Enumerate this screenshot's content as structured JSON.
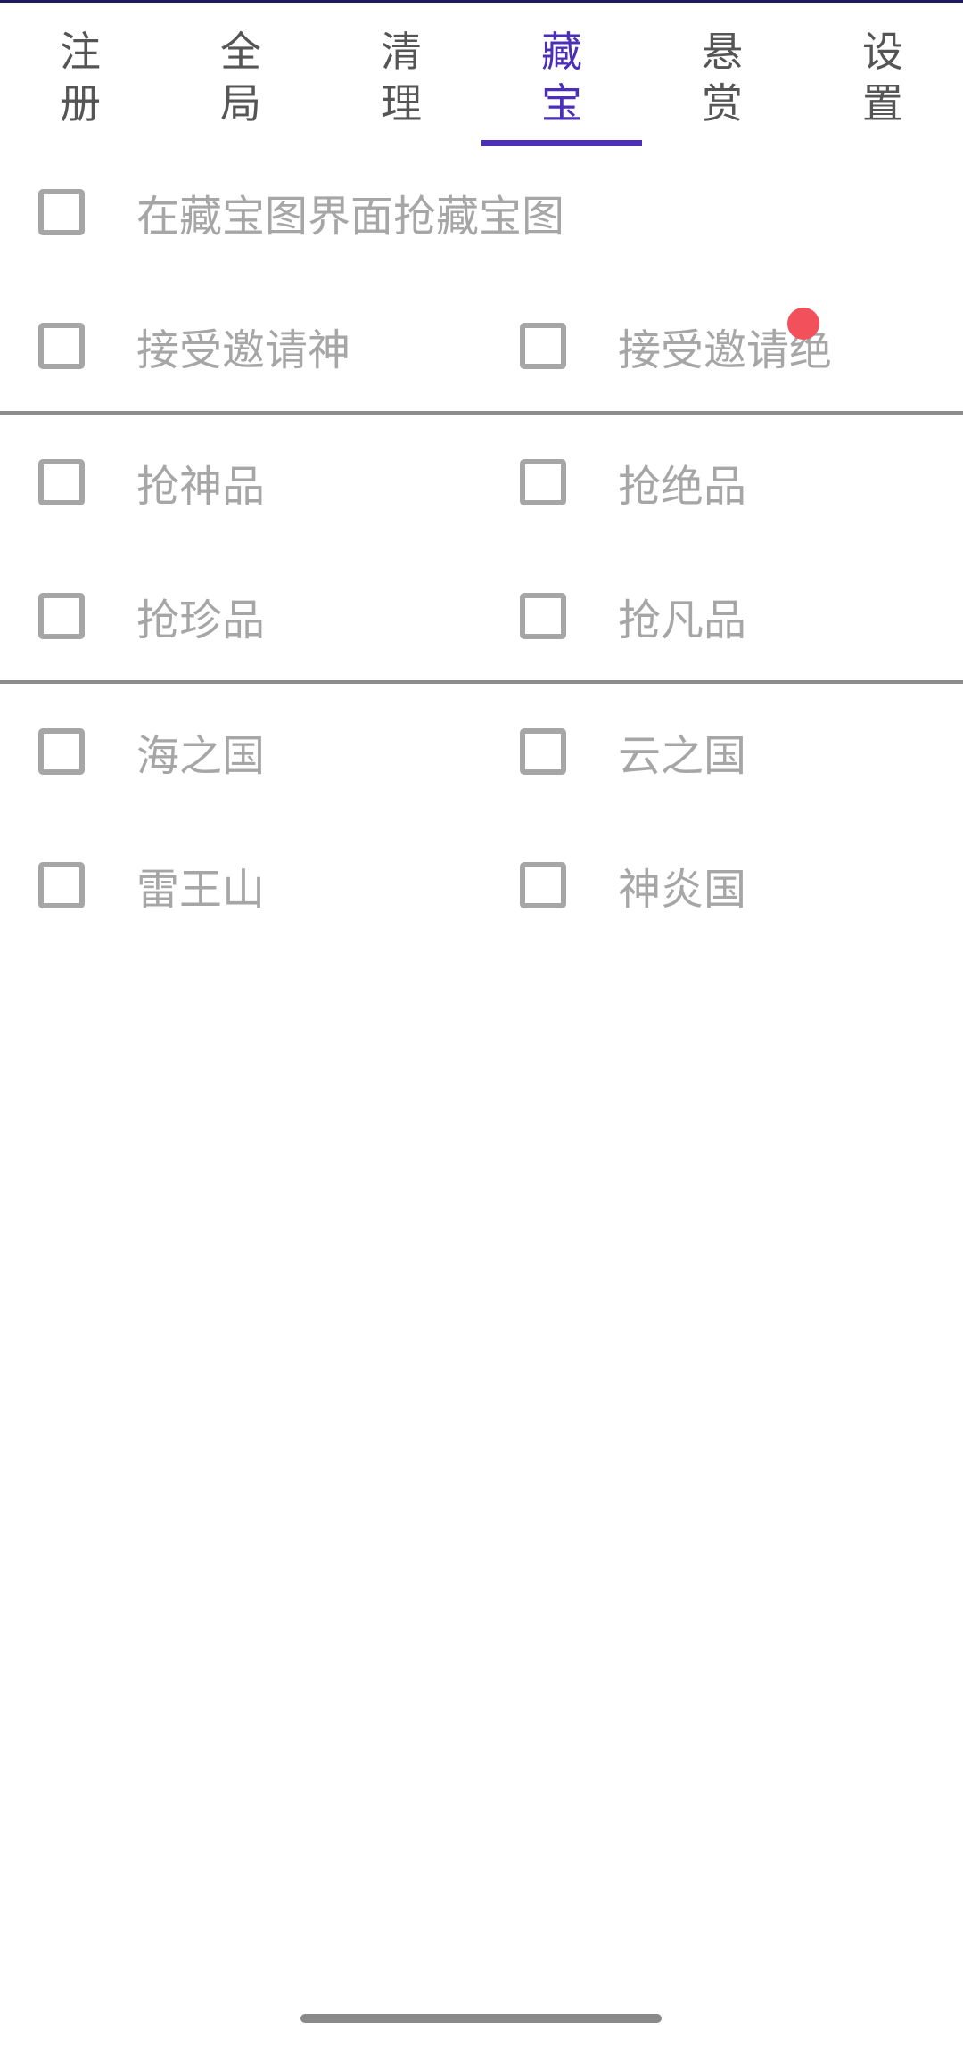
{
  "tabs": [
    {
      "line1": "注",
      "line2": "册"
    },
    {
      "line1": "全",
      "line2": "局"
    },
    {
      "line1": "清",
      "line2": "理"
    },
    {
      "line1": "藏",
      "line2": "宝"
    },
    {
      "line1": "悬",
      "line2": "赏"
    },
    {
      "line1": "设",
      "line2": "置"
    }
  ],
  "active_tab_index": 3,
  "colors": {
    "accent": "#4b2fb8",
    "checkbox_border": "#a6a6a6",
    "label_text": "#a6a6a6",
    "divider": "#8c8c8c",
    "notification_dot": "#f2505a"
  },
  "options": {
    "grab_map_in_map_screen": {
      "label": "在藏宝图界面抢藏宝图",
      "checked": false
    },
    "accept_invite_shen": {
      "label": "接受邀请神",
      "checked": false
    },
    "accept_invite_jue": {
      "label": "接受邀请绝",
      "checked": false
    },
    "grab_shen": {
      "label": "抢神品",
      "checked": false
    },
    "grab_jue": {
      "label": "抢绝品",
      "checked": false
    },
    "grab_zhen": {
      "label": "抢珍品",
      "checked": false
    },
    "grab_fan": {
      "label": "抢凡品",
      "checked": false
    },
    "sea_kingdom": {
      "label": "海之国",
      "checked": false
    },
    "cloud_kingdom": {
      "label": "云之国",
      "checked": false
    },
    "thunder_king_mountain": {
      "label": "雷王山",
      "checked": false
    },
    "divine_flame_kingdom": {
      "label": "神炎国",
      "checked": false
    }
  }
}
